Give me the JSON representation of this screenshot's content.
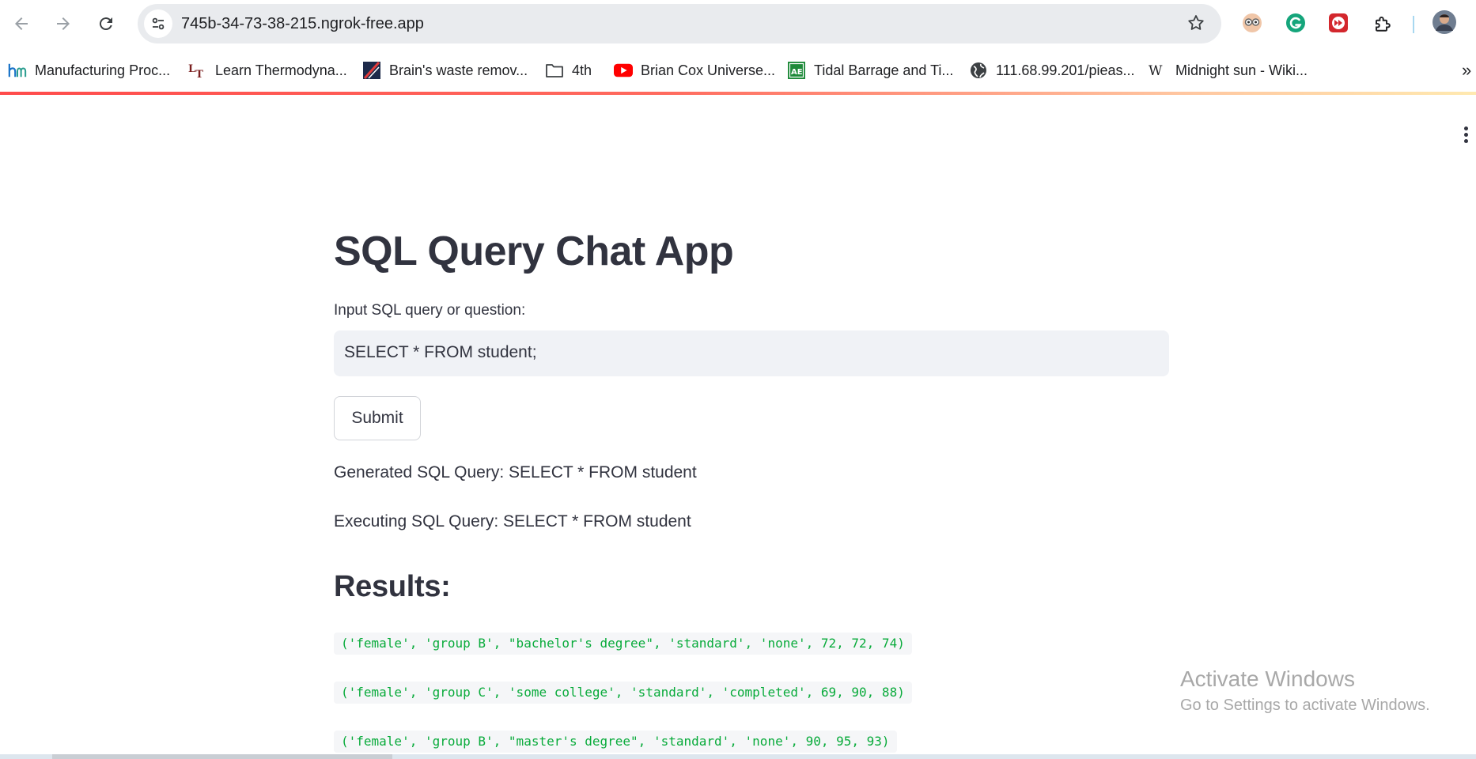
{
  "browser": {
    "url": "745b-34-73-38-215.ngrok-free.app",
    "bookmarks": [
      {
        "label": "Manufacturing Proc...",
        "icon": "hm-logo-icon"
      },
      {
        "label": "Learn Thermodyna...",
        "icon": "lt-logo-icon"
      },
      {
        "label": "Brain's waste remov...",
        "icon": "site-logo-icon"
      },
      {
        "label": "4th",
        "icon": "folder-icon"
      },
      {
        "label": "Brian Cox Universe...",
        "icon": "youtube-icon"
      },
      {
        "label": "Tidal Barrage and Ti...",
        "icon": "ae-logo-icon"
      },
      {
        "label": "111.68.99.201/pieas...",
        "icon": "globe-icon"
      },
      {
        "label": "Midnight sun - Wiki...",
        "icon": "wikipedia-icon"
      }
    ],
    "more": "»"
  },
  "app": {
    "title": "SQL Query Chat App",
    "input_label": "Input SQL query or question:",
    "input_value": "SELECT * FROM student;",
    "submit_label": "Submit",
    "generated": "Generated SQL Query: SELECT * FROM student",
    "executing": "Executing SQL Query: SELECT * FROM student",
    "results_heading": "Results:",
    "results": [
      "('female', 'group B', \"bachelor's degree\", 'standard', 'none', 72, 72, 74)",
      "('female', 'group C', 'some college', 'standard', 'completed', 69, 90, 88)",
      "('female', 'group B', \"master's degree\", 'standard', 'none', 90, 95, 93)"
    ]
  },
  "watermark": {
    "line1": "Activate Windows",
    "line2": "Go to Settings to activate Windows."
  },
  "colors": {
    "accent": "#ff4b4b",
    "result_text": "#09ab3b",
    "input_bg": "#f0f2f6"
  }
}
